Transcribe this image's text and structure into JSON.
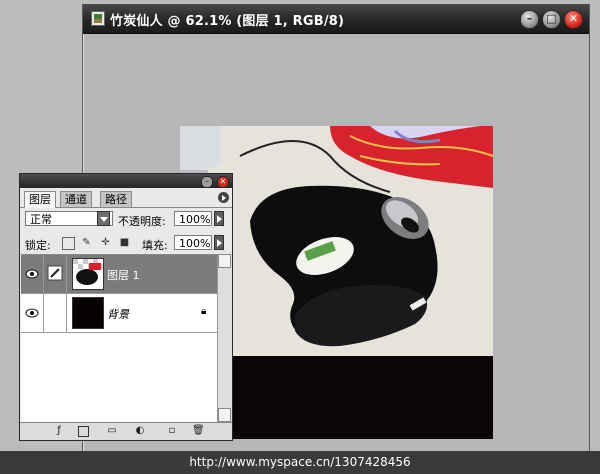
{
  "document_window": {
    "title": "竹炭仙人 @ 62.1% (图层 1, RGB/8)",
    "buttons": {
      "minimize": "–",
      "maximize": "□",
      "close": "✕"
    }
  },
  "layers_panel": {
    "tabs": [
      "图层",
      "通道",
      "路径"
    ],
    "blend_mode": "正常",
    "opacity_label": "不透明度:",
    "opacity_value": "100%",
    "lock_label": "锁定:",
    "fill_label": "填充:",
    "fill_value": "100%",
    "layers": [
      {
        "name": "图层 1",
        "selected": true,
        "visible": true
      },
      {
        "name": "背景",
        "selected": false,
        "visible": true,
        "locked": true
      }
    ],
    "bottom_icons": [
      "link-icon",
      "layer-style-icon",
      "mask-icon",
      "new-group-icon",
      "adjustment-layer-icon",
      "new-layer-icon",
      "trash-icon"
    ]
  },
  "status_bar": {
    "text": "http://www.myspace.cn/1307428456"
  },
  "colors": {
    "titlebar": "#2a2a2a",
    "canvas_bg": "#0b0508",
    "selected_layer": "#7b7b7b"
  }
}
